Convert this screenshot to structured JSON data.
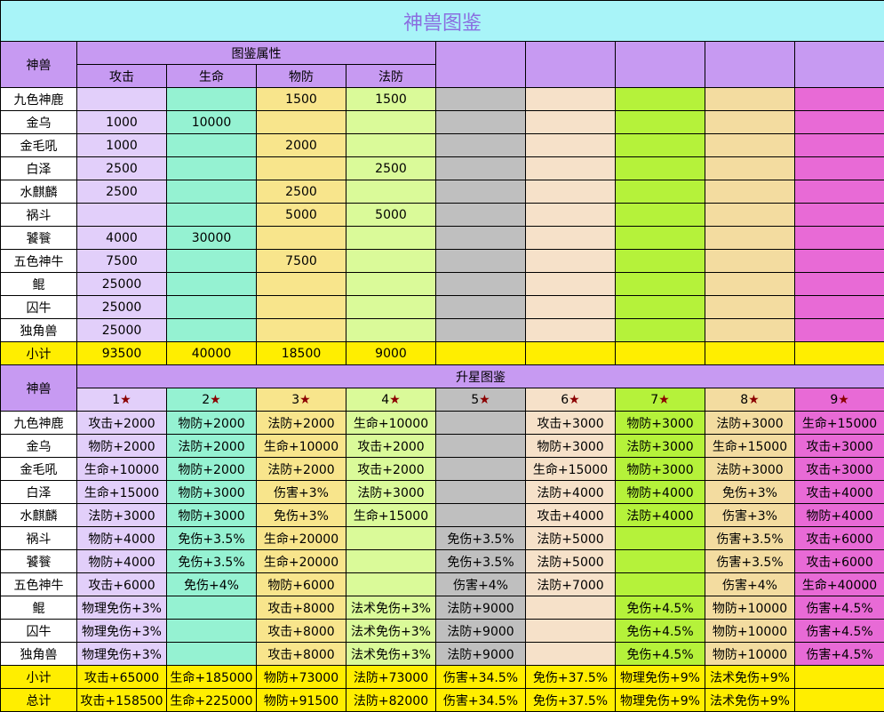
{
  "title": "神兽图鉴",
  "beast_header": "神兽",
  "attr_section": {
    "header": "图鉴属性",
    "columns": [
      "攻击",
      "生命",
      "物防",
      "法防"
    ],
    "rows": [
      {
        "name": "九色神鹿",
        "vals": [
          "",
          "",
          "1500",
          "1500"
        ]
      },
      {
        "name": "金乌",
        "vals": [
          "1000",
          "10000",
          "",
          ""
        ]
      },
      {
        "name": "金毛吼",
        "vals": [
          "1000",
          "",
          "2000",
          ""
        ]
      },
      {
        "name": "白泽",
        "vals": [
          "2500",
          "",
          "",
          "2500"
        ]
      },
      {
        "name": "水麒麟",
        "vals": [
          "2500",
          "",
          "2500",
          ""
        ]
      },
      {
        "name": "祸斗",
        "vals": [
          "",
          "",
          "5000",
          "5000"
        ]
      },
      {
        "name": "饕餮",
        "vals": [
          "4000",
          "30000",
          "",
          ""
        ]
      },
      {
        "name": "五色神牛",
        "vals": [
          "7500",
          "",
          "7500",
          ""
        ]
      },
      {
        "name": "鲲",
        "vals": [
          "25000",
          "",
          "",
          ""
        ]
      },
      {
        "name": "囚牛",
        "vals": [
          "25000",
          "",
          "",
          ""
        ]
      },
      {
        "name": "独角兽",
        "vals": [
          "25000",
          "",
          "",
          ""
        ]
      }
    ],
    "subtotal_label": "小计",
    "subtotal": [
      "93500",
      "40000",
      "18500",
      "9000"
    ]
  },
  "star_section": {
    "header": "升星图鉴",
    "star_columns": [
      "1",
      "2",
      "3",
      "4",
      "5",
      "6",
      "7",
      "8",
      "9"
    ],
    "star_glyph": "★",
    "rows": [
      {
        "name": "九色神鹿",
        "vals": [
          "攻击+2000",
          "物防+2000",
          "法防+2000",
          "生命+10000",
          "",
          "攻击+3000",
          "物防+3000",
          "法防+3000",
          "生命+15000"
        ]
      },
      {
        "name": "金乌",
        "vals": [
          "物防+2000",
          "法防+2000",
          "生命+10000",
          "攻击+2000",
          "",
          "物防+3000",
          "法防+3000",
          "生命+15000",
          "攻击+3000"
        ]
      },
      {
        "name": "金毛吼",
        "vals": [
          "生命+10000",
          "物防+2000",
          "法防+2000",
          "攻击+2000",
          "",
          "生命+15000",
          "物防+3000",
          "法防+3000",
          "攻击+3000"
        ]
      },
      {
        "name": "白泽",
        "vals": [
          "生命+15000",
          "物防+3000",
          "伤害+3%",
          "法防+3000",
          "",
          "法防+4000",
          "物防+4000",
          "免伤+3%",
          "攻击+4000"
        ]
      },
      {
        "name": "水麒麟",
        "vals": [
          "法防+3000",
          "物防+3000",
          "免伤+3%",
          "生命+15000",
          "",
          "攻击+4000",
          "法防+4000",
          "伤害+3%",
          "物防+4000"
        ]
      },
      {
        "name": "祸斗",
        "vals": [
          "物防+4000",
          "免伤+3.5%",
          "生命+20000",
          "",
          "免伤+3.5%",
          "法防+5000",
          "",
          "伤害+3.5%",
          "攻击+6000"
        ]
      },
      {
        "name": "饕餮",
        "vals": [
          "物防+4000",
          "免伤+3.5%",
          "生命+20000",
          "",
          "免伤+3.5%",
          "法防+5000",
          "",
          "伤害+3.5%",
          "攻击+6000"
        ]
      },
      {
        "name": "五色神牛",
        "vals": [
          "攻击+6000",
          "免伤+4%",
          "物防+6000",
          "",
          "伤害+4%",
          "法防+7000",
          "",
          "伤害+4%",
          "生命+40000"
        ]
      },
      {
        "name": "鲲",
        "vals": [
          "物理免伤+3%",
          "",
          "攻击+8000",
          "法术免伤+3%",
          "法防+9000",
          "",
          "免伤+4.5%",
          "物防+10000",
          "伤害+4.5%"
        ]
      },
      {
        "name": "囚牛",
        "vals": [
          "物理免伤+3%",
          "",
          "攻击+8000",
          "法术免伤+3%",
          "法防+9000",
          "",
          "免伤+4.5%",
          "物防+10000",
          "伤害+4.5%"
        ]
      },
      {
        "name": "独角兽",
        "vals": [
          "物理免伤+3%",
          "",
          "攻击+8000",
          "法术免伤+3%",
          "法防+9000",
          "",
          "免伤+4.5%",
          "物防+10000",
          "伤害+4.5%"
        ]
      }
    ],
    "subtotal_label": "小计",
    "subtotal": [
      "攻击+65000",
      "生命+185000",
      "物防+73000",
      "法防+73000",
      "伤害+34.5%",
      "免伤+37.5%",
      "物理免伤+9%",
      "法术免伤+9%",
      ""
    ],
    "total_label": "总计",
    "total": [
      "攻击+158500",
      "生命+225000",
      "物防+91500",
      "法防+82000",
      "伤害+34.5%",
      "免伤+37.5%",
      "物理免伤+9%",
      "法术免伤+9%",
      ""
    ]
  },
  "chart_data": {
    "type": "table",
    "title": "神兽图鉴",
    "tables": [
      {
        "name": "图鉴属性",
        "row_header": "神兽",
        "columns": [
          "攻击",
          "生命",
          "物防",
          "法防"
        ],
        "rows": [
          "九色神鹿",
          "金乌",
          "金毛吼",
          "白泽",
          "水麒麟",
          "祸斗",
          "饕餮",
          "五色神牛",
          "鲲",
          "囚牛",
          "独角兽",
          "小计"
        ]
      },
      {
        "name": "升星图鉴",
        "row_header": "神兽",
        "columns": [
          "1★",
          "2★",
          "3★",
          "4★",
          "5★",
          "6★",
          "7★",
          "8★",
          "9★"
        ],
        "rows": [
          "九色神鹿",
          "金乌",
          "金毛吼",
          "白泽",
          "水麒麟",
          "祸斗",
          "饕餮",
          "五色神牛",
          "鲲",
          "囚牛",
          "独角兽",
          "小计",
          "总计"
        ]
      }
    ]
  },
  "colors": {
    "title_bg": "#a8f4f8",
    "title_text": "#8a6ee0",
    "header_bg": "#c79af2",
    "subtotal_bg": "#ffee00",
    "columns": [
      "#e2cffa",
      "#95f2d2",
      "#f8e58c",
      "#dafa99",
      "#bfbfbf",
      "#f6e1c9",
      "#b5f23a",
      "#f3dca0",
      "#e86ad6"
    ],
    "star_mark": "#8b0000"
  },
  "watermark": "seal-stamp-watermark"
}
